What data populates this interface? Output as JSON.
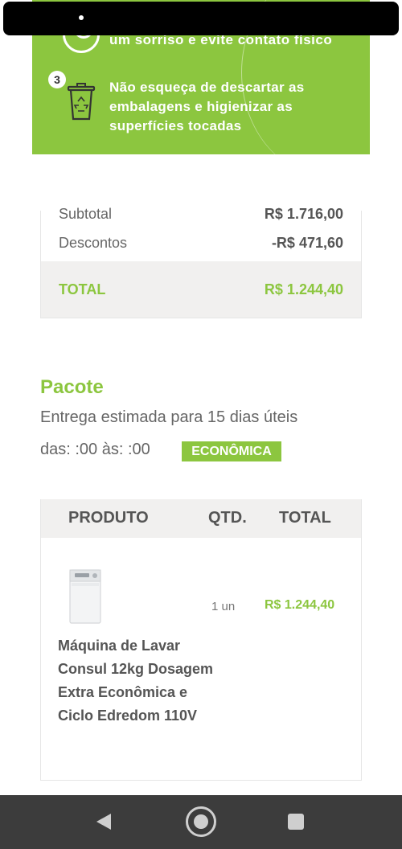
{
  "banner": {
    "smile_text": "um sorriso e evite contato físico",
    "step_number": "3",
    "step_text": "Não esqueça de descartar as embalagens e higienizar as superfícies tocadas"
  },
  "summary": {
    "subtotal_label": "Subtotal",
    "subtotal_value": "R$ 1.716,00",
    "discounts_label": "Descontos",
    "discounts_value": "-R$ 471,60",
    "total_label": "TOTAL",
    "total_value": "R$ 1.244,40"
  },
  "package": {
    "title": "Pacote",
    "delivery": "Entrega estimada para 15 dias úteis",
    "time": "das: :00 às: :00",
    "badge": "ECONÔMICA"
  },
  "table": {
    "headers": [
      "PRODUTO",
      "QTD.",
      "TOTAL"
    ],
    "rows": [
      {
        "name": "Máquina de Lavar Consul 12kg Dosagem Extra Econômica e Ciclo Edredom 110V",
        "qty": "1 un",
        "total": "R$ 1.244,40"
      }
    ]
  },
  "colors": {
    "accent": "#8cc63f",
    "strip": "#f1f0ef",
    "nav": "#3c3c3c"
  },
  "icons": [
    "smile-icon",
    "recycle-bin-icon",
    "washing-machine-image",
    "back-icon",
    "home-icon",
    "recent-apps-icon"
  ]
}
